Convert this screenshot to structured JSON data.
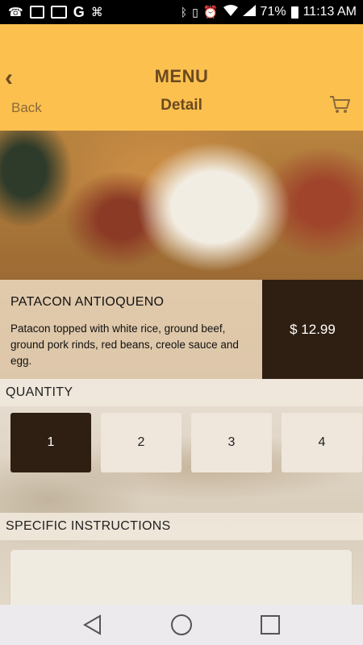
{
  "status_bar": {
    "battery": "71%",
    "time": "11:13 AM",
    "icons_left": [
      "missed-call-icon",
      "image-icon",
      "gmail-icon",
      "google-icon",
      "usb-icon"
    ],
    "icons_right": [
      "bluetooth-icon",
      "vibrate-icon",
      "alarm-icon",
      "wifi-icon",
      "signal-icon",
      "battery-icon"
    ]
  },
  "header": {
    "title": "MENU",
    "back_label": "Back",
    "subtitle": "Detail",
    "accent_color": "#fcc04f"
  },
  "dish": {
    "name": "PATACON ANTIOQUENO",
    "description": "Patacon topped with white rice, ground beef, ground pork rinds, red beans, creole sauce and egg.",
    "price": "$ 12.99"
  },
  "quantity": {
    "label": "QUANTITY",
    "options": [
      "1",
      "2",
      "3",
      "4"
    ],
    "selected": "1"
  },
  "instructions": {
    "label": "SPECIFIC INSTRUCTIONS",
    "value": ""
  },
  "navbar": {
    "buttons": [
      "back-triangle-icon",
      "home-circle-icon",
      "recents-square-icon"
    ]
  }
}
